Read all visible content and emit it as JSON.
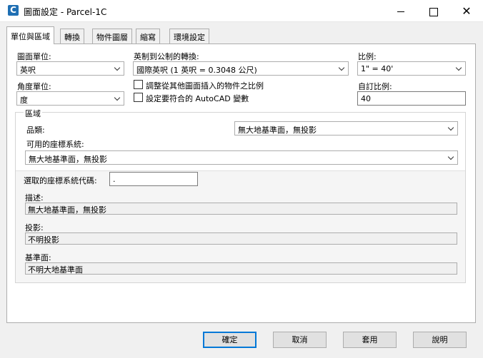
{
  "window": {
    "title": "圖面設定 - Parcel-1C",
    "app_icon": "C",
    "controls": [
      "minimize-icon",
      "maximize-icon",
      "close-icon"
    ]
  },
  "tabs": [
    {
      "label": "單位與區域",
      "active": true
    },
    {
      "label": "轉換",
      "active": false
    },
    {
      "label": "物件圖層",
      "active": false
    },
    {
      "label": "縮寫",
      "active": false
    },
    {
      "label": "環境設定",
      "active": false
    }
  ],
  "units": {
    "drawing_units_label": "圖面單位:",
    "drawing_units_value": "英呎",
    "angular_units_label": "角度單位:",
    "angular_units_value": "度"
  },
  "conversion": {
    "label": "英制到公制的轉換:",
    "value": "國際英呎 (1 英呎 = 0.3048 公尺)",
    "scale_objects_label": "調整從其他圖面插入的物件之比例",
    "scale_objects_checked": false,
    "set_variables_label": "設定要符合的 AutoCAD 變數",
    "set_variables_checked": false
  },
  "scale": {
    "label": "比例:",
    "value": "1\" = 40'",
    "custom_label": "自訂比例:",
    "custom_value": "40"
  },
  "zone": {
    "group_label": "區域",
    "category_label": "品類:",
    "category_value": "無大地基準面，無投影",
    "available_cs_label": "可用的座標系統:",
    "available_cs_value": "無大地基準面，無投影",
    "selected_code_label": "選取的座標系統代碼:",
    "selected_code_value": ".",
    "description_label": "描述:",
    "description_value": "無大地基準面，無投影",
    "projection_label": "投影:",
    "projection_value": "不明投影",
    "datum_label": "基準面:",
    "datum_value": "不明大地基準面"
  },
  "buttons": {
    "ok": "確定",
    "cancel": "取消",
    "apply": "套用",
    "help": "說明"
  }
}
